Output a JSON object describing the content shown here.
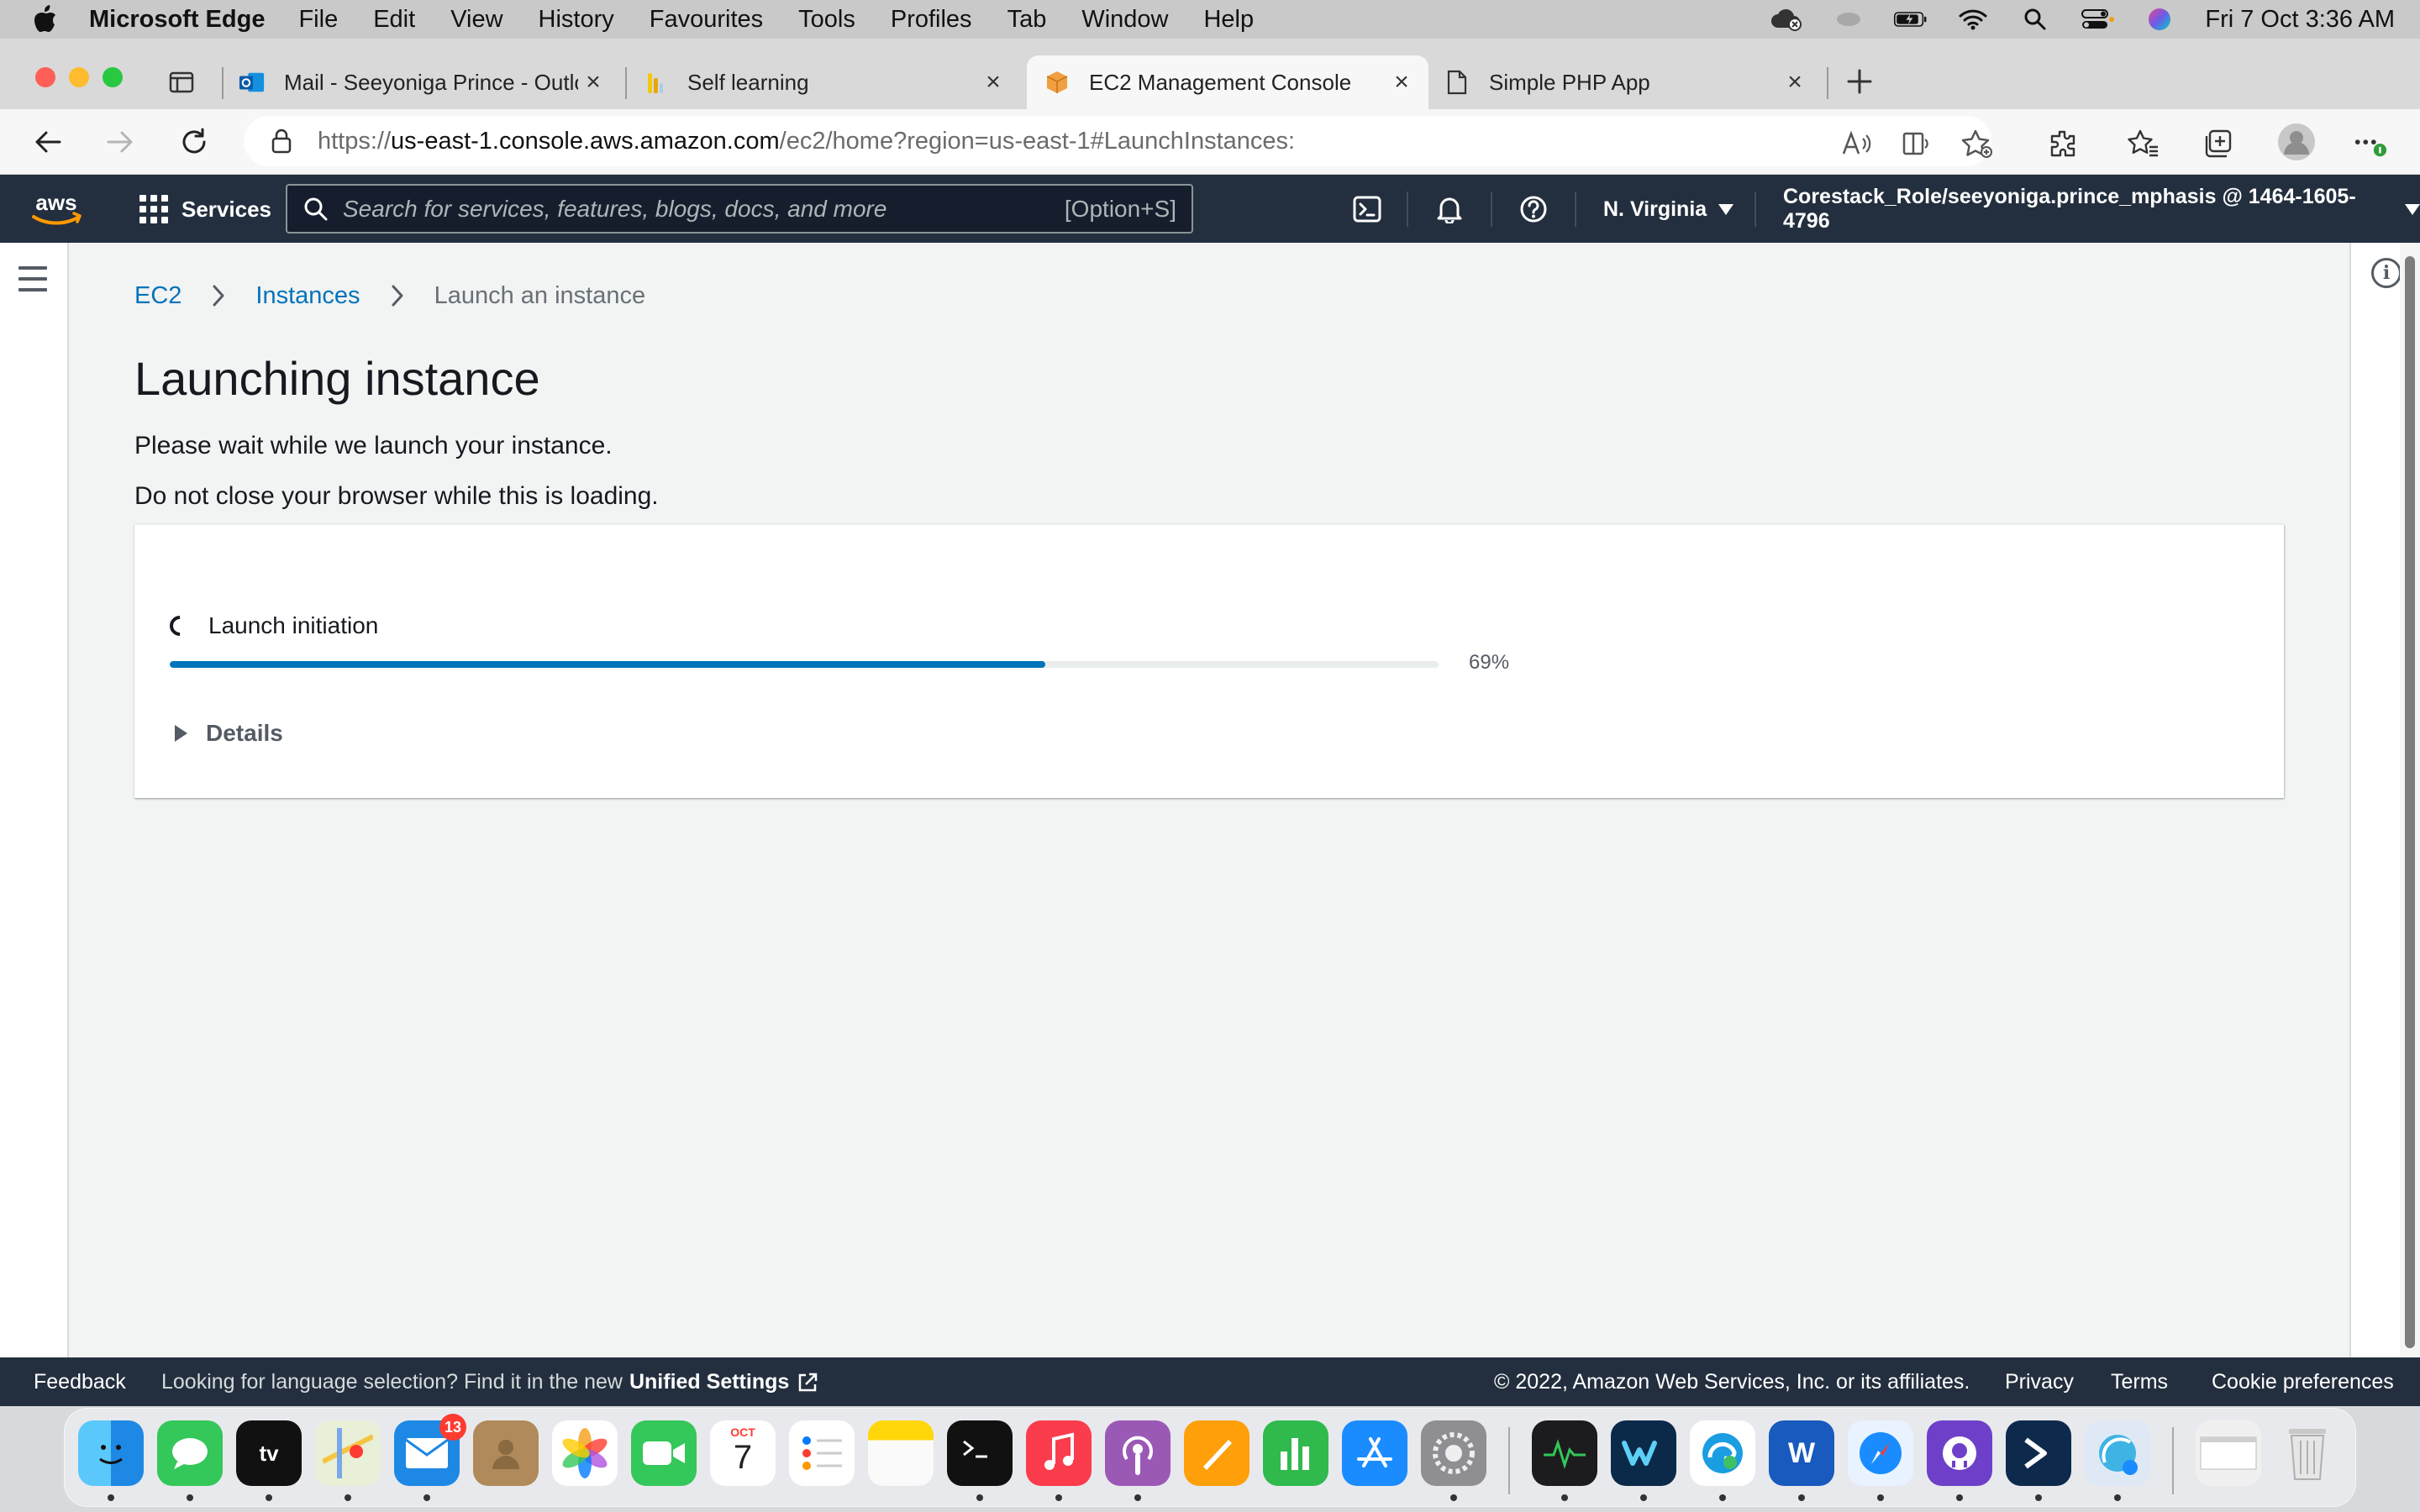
{
  "menubar": {
    "app_name": "Microsoft Edge",
    "items": [
      "File",
      "Edit",
      "View",
      "History",
      "Favourites",
      "Tools",
      "Profiles",
      "Tab",
      "Window",
      "Help"
    ],
    "clock": "Fri 7 Oct  3:36 AM"
  },
  "tabs": [
    {
      "label": "Mail - Seeyoniga Prince - Outlo",
      "icon": "outlook-icon",
      "active": false
    },
    {
      "label": "Self learning",
      "icon": "chart-icon",
      "active": false
    },
    {
      "label": "EC2 Management Console",
      "icon": "aws-box-icon",
      "active": true
    },
    {
      "label": "Simple PHP App",
      "icon": "page-icon",
      "active": false
    }
  ],
  "address": {
    "scheme": "https://",
    "host": "us-east-1.console.aws.amazon.com",
    "path": "/ec2/home?region=us-east-1#LaunchInstances:"
  },
  "aws_nav": {
    "logo": "aws",
    "services_label": "Services",
    "search_placeholder": "Search for services, features, blogs, docs, and more",
    "search_shortcut": "[Option+S]",
    "region": "N. Virginia",
    "account": "Corestack_Role/seeyoniga.prince_mphasis @ 1464-1605-4796"
  },
  "breadcrumb": {
    "items": [
      "EC2",
      "Instances"
    ],
    "current": "Launch an instance"
  },
  "main": {
    "title": "Launching instance",
    "message1": "Please wait while we launch your instance.",
    "message2": "Do not close your browser while this is loading."
  },
  "progress": {
    "step_label": "Launch initiation",
    "percent": 69,
    "percent_label": "69%",
    "details_label": "Details"
  },
  "footer": {
    "feedback": "Feedback",
    "language_text": "Looking for language selection? Find it in the new",
    "unified_settings": "Unified Settings",
    "copyright": "© 2022, Amazon Web Services, Inc. or its affiliates.",
    "links": [
      "Privacy",
      "Terms",
      "Cookie preferences"
    ]
  },
  "dock": {
    "mail_badge": "13",
    "calendar_month": "OCT",
    "calendar_day": "7"
  },
  "colors": {
    "aws_nav": "#232f3e",
    "link": "#0073bb",
    "progress": "#0073bb",
    "page_bg": "#f2f3f3"
  }
}
